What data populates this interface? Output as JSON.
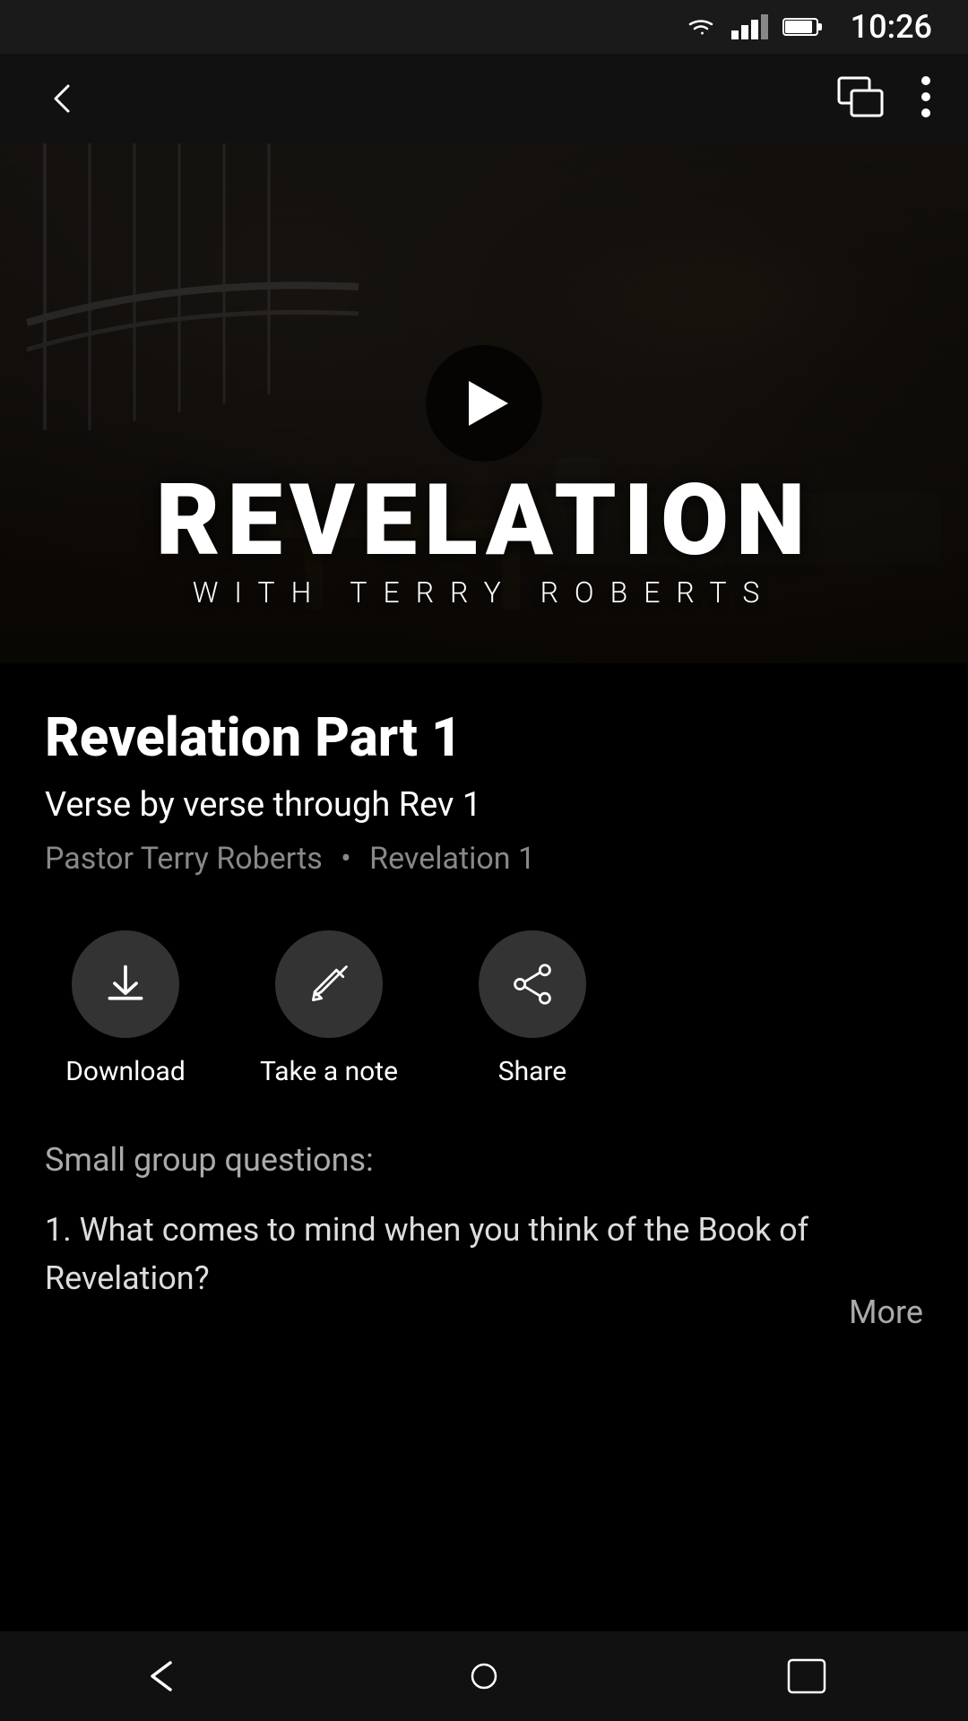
{
  "statusBar": {
    "time": "10:26"
  },
  "header": {
    "backLabel": "back",
    "chatIconLabel": "chat-icon",
    "moreIconLabel": "more-options-icon"
  },
  "video": {
    "title": "REVELATION",
    "subtitle": "WITH TERRY ROBERTS",
    "playButton": "play"
  },
  "sermon": {
    "title": "Revelation Part 1",
    "subtitle": "Verse by verse through Rev 1",
    "pastor": "Pastor Terry Roberts",
    "series": "Revelation 1",
    "separator": "•"
  },
  "actions": {
    "download": {
      "label": "Download"
    },
    "note": {
      "label": "Take a note"
    },
    "share": {
      "label": "Share"
    }
  },
  "description": {
    "sectionLabel": "Small group questions:",
    "questionText": "1. What comes to mind when you think of the Book of Revelation?",
    "moreLabel": "More"
  },
  "bottomNav": {
    "back": "back-nav",
    "home": "home-nav",
    "recent": "recent-nav"
  }
}
